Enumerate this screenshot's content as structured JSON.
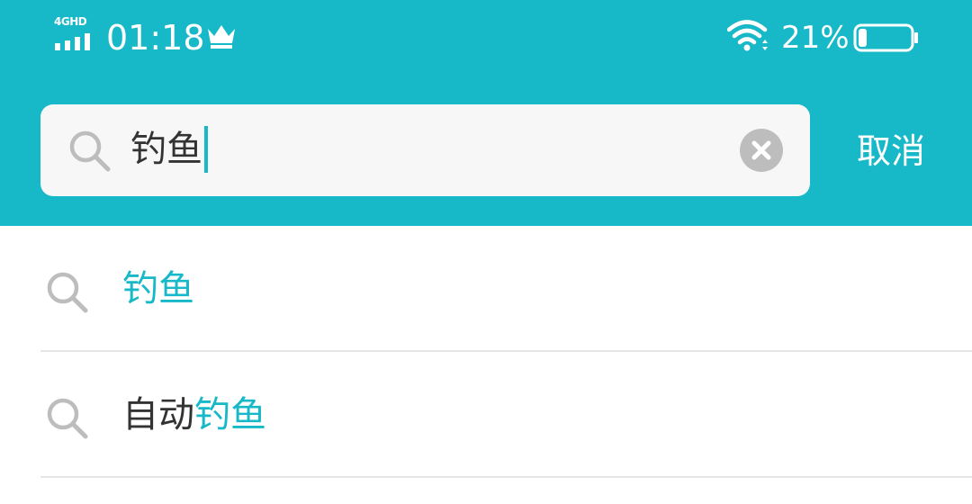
{
  "status_bar": {
    "network_type": "4GHD",
    "time": "01:18",
    "battery_percent": "21%",
    "icons": [
      "signal-icon",
      "crown-icon",
      "wifi-icon",
      "battery-icon"
    ]
  },
  "search": {
    "query": "钓鱼",
    "cancel_label": "取消",
    "icons": [
      "search-icon",
      "clear-icon"
    ]
  },
  "suggestions": [
    {
      "prefix": "",
      "highlight": "钓鱼"
    },
    {
      "prefix": "自动",
      "highlight": "钓鱼"
    }
  ],
  "colors": {
    "accent": "#17b8c7",
    "search_bg": "#f7f7f7",
    "text": "#333333",
    "icon_gray": "#bdbdbd",
    "divider": "#e6e6e6"
  }
}
